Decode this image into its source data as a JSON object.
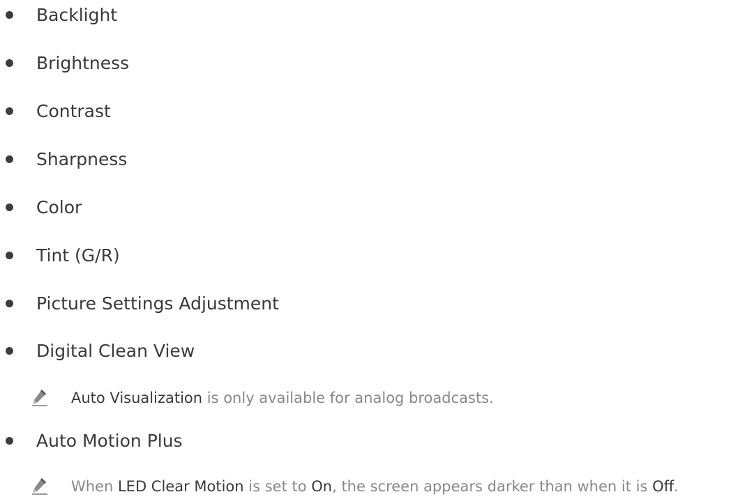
{
  "items": [
    {
      "label": "Backlight"
    },
    {
      "label": "Brightness"
    },
    {
      "label": "Contrast"
    },
    {
      "label": "Sharpness"
    },
    {
      "label": "Color"
    },
    {
      "label": "Tint (G/R)"
    },
    {
      "label": "Picture Settings Adjustment"
    },
    {
      "label": "Digital Clean View"
    },
    {
      "label": "Auto Motion Plus"
    }
  ],
  "notes": {
    "digital_clean_view": {
      "kw1": "Auto Visualization",
      "t1": " is only available for analog broadcasts."
    },
    "auto_motion_plus": {
      "t0": "When ",
      "kw1": "LED Clear Motion",
      "t1": " is set to ",
      "kw2": "On",
      "t2": ", the screen appears darker than when it is ",
      "kw3": "Off",
      "t3": "."
    }
  },
  "icons": {
    "bullet": "bullet-dot",
    "note": "pencil-icon"
  }
}
